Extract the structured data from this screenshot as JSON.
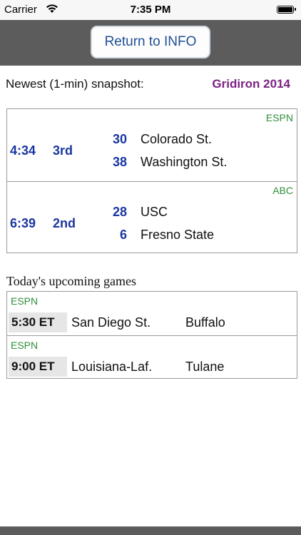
{
  "status_bar": {
    "carrier": "Carrier",
    "time": "7:35 PM"
  },
  "header": {
    "return_button_label": "Return to INFO"
  },
  "snapshot": {
    "label": "Newest (1-min) snapshot:",
    "brand": "Gridiron 2014"
  },
  "live_games": [
    {
      "network": "ESPN",
      "clock": "4:34",
      "period": "3rd",
      "away_score": "30",
      "away_team": "Colorado St.",
      "home_score": "38",
      "home_team": "Washington St."
    },
    {
      "network": "ABC",
      "clock": "6:39",
      "period": "2nd",
      "away_score": "28",
      "away_team": "USC",
      "home_score": "6",
      "home_team": "Fresno State"
    }
  ],
  "upcoming": {
    "title": "Today's upcoming games",
    "games": [
      {
        "network": "ESPN",
        "kickoff": "5:30 ET",
        "away_team": "San Diego St.",
        "home_team": "Buffalo"
      },
      {
        "network": "ESPN",
        "kickoff": "9:00 ET",
        "away_team": "Louisiana-Laf.",
        "home_team": "Tulane"
      }
    ]
  },
  "colors": {
    "header_bg": "#5c5c5c",
    "score_blue": "#1a36a0",
    "brand_purple": "#7b2284",
    "network_green": "#2f8f3a"
  }
}
